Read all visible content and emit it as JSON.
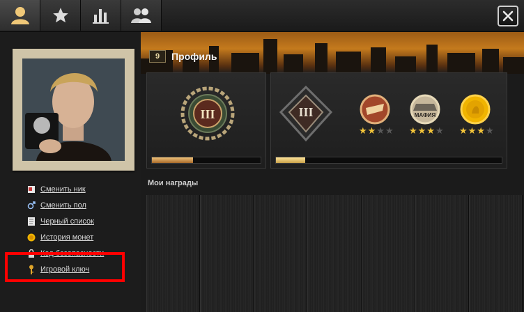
{
  "tabs": [
    {
      "name": "profile",
      "icon": "user-icon",
      "active": true
    },
    {
      "name": "favorites",
      "icon": "star-icon",
      "active": false
    },
    {
      "name": "stats",
      "icon": "bar-chart-icon",
      "active": false
    },
    {
      "name": "friends",
      "icon": "group-icon",
      "active": false
    }
  ],
  "close_icon": "close-icon",
  "profile": {
    "level": "9",
    "title": "Профиль"
  },
  "sidebar": {
    "items": [
      {
        "label": "Сменить ник",
        "icon": "rename-icon"
      },
      {
        "label": "Сменить пол",
        "icon": "gender-icon"
      },
      {
        "label": "Черный список",
        "icon": "document-icon"
      },
      {
        "label": "История монет",
        "icon": "coin-icon"
      },
      {
        "label": "Код безопасности",
        "icon": "lock-icon"
      },
      {
        "label": "Игровой ключ",
        "icon": "key-icon"
      }
    ]
  },
  "ranks": {
    "left_rank": "III",
    "right_rank": "III",
    "left_progress": 0.38,
    "right_progress": 0.13,
    "achievements": [
      {
        "icon": "pizza-icon",
        "stars": 2,
        "max": 4
      },
      {
        "icon": "mafia-hat-icon",
        "label": "МАФИЯ",
        "stars": 3,
        "max": 4
      },
      {
        "icon": "gold-coin-icon",
        "stars": 3,
        "max": 4
      }
    ]
  },
  "awards": {
    "title": "Мои награды",
    "slots": 7
  },
  "colors": {
    "accent_gold": "#f3c43a",
    "highlight_red": "#ff0000",
    "progress": "#d9a25e"
  }
}
